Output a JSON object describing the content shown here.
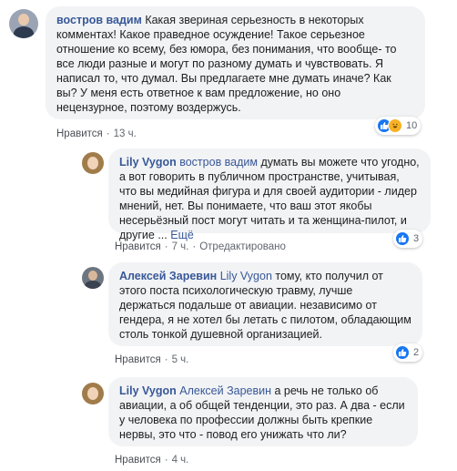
{
  "comments": [
    {
      "author": "востров вадим",
      "text": "Какая звериная серьезность в некоторых комментах! Какое праведное осуждение! Такое серьезное отношение ко всему, без юмора, без понимания, что вообще- то все люди разные и могут по разному думать и чувствовать. Я написал то, что думал. Вы предлагаете мне думать иначе? Как вы? У меня есть ответное к вам предложение, но оно нецензурное, поэтому воздержусь.",
      "like_label": "Нравится",
      "time": "13 ч.",
      "reaction_count": "10",
      "reactions": [
        "like",
        "haha"
      ]
    },
    {
      "author": "Lily Vygon",
      "mention": "востров вадим",
      "text": "думать вы можете что угодно, а вот говорить в публичном пространстве, учитывая, что вы медийная фигура и для своей аудитории - лидер мнений, нет. Вы понимаете, что ваш этот якобы несерьёзный пост могут читать и та женщина-пилот, и другие ...",
      "more": "Ещё",
      "like_label": "Нравится",
      "time": "7 ч.",
      "edited": "Отредактировано",
      "reaction_count": "3",
      "reactions": [
        "like"
      ]
    },
    {
      "author": "Алексей Заревин",
      "mention": "Lily Vygon",
      "text": "тому, кто получил от этого поста психологическую травму, лучше держаться подальше от авиации. независимо от гендера, я не хотел бы летать с пилотом, обладающим столь тонкой душевной организацией.",
      "like_label": "Нравится",
      "time": "5 ч.",
      "reaction_count": "2",
      "reactions": [
        "like"
      ]
    },
    {
      "author": "Lily Vygon",
      "mention": "Алексей Заревин",
      "text": "а речь не только об авиации, а об общей тенденции, это раз. А два - если у человека по профессии должны быть крепкие нервы, это что - повод его унижать что ли?",
      "like_label": "Нравится",
      "time": "4 ч."
    }
  ],
  "colors": {
    "link": "#385898",
    "bubble": "#f2f3f5",
    "like": "#1877f2",
    "haha": "#f7b125"
  }
}
